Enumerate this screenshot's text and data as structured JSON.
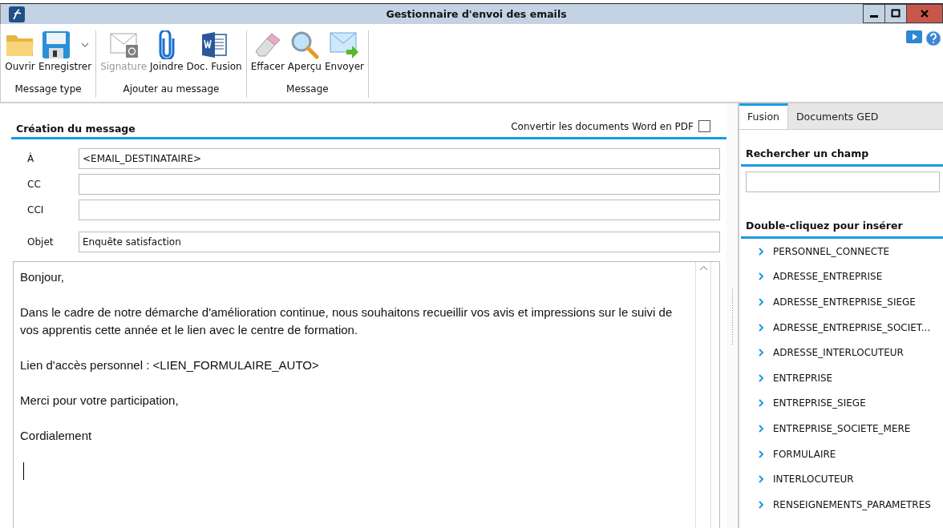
{
  "window": {
    "title": "Gestionnaire d'envoi des emails"
  },
  "toolbar": {
    "groups": [
      {
        "label": "Message type",
        "buttons": [
          {
            "label": "Ouvrir",
            "kind": "folder",
            "disabled": false,
            "dropdown": false
          },
          {
            "label": "Enregistrer",
            "kind": "save",
            "disabled": false,
            "dropdown": true
          }
        ]
      },
      {
        "label": "Ajouter au message",
        "buttons": [
          {
            "label": "Signature",
            "kind": "signature",
            "disabled": true,
            "dropdown": false
          },
          {
            "label": "Joindre",
            "kind": "clip",
            "disabled": false,
            "dropdown": false
          },
          {
            "label": "Doc. Fusion",
            "kind": "word",
            "disabled": false,
            "dropdown": false
          }
        ]
      },
      {
        "label": "Message",
        "buttons": [
          {
            "label": "Effacer",
            "kind": "eraser",
            "disabled": false,
            "dropdown": false
          },
          {
            "label": "Aperçu",
            "kind": "magnifier",
            "disabled": false,
            "dropdown": false
          },
          {
            "label": "Envoyer",
            "kind": "send",
            "disabled": false,
            "dropdown": false
          }
        ]
      }
    ]
  },
  "composer": {
    "title": "Création du message",
    "convert_pdf": {
      "label": "Convertir les documents Word en PDF",
      "checked": false
    },
    "fields": [
      {
        "label": "À",
        "value": "<EMAIL_DESTINATAIRE>"
      },
      {
        "label": "CC"
      },
      {
        "label": "CCI"
      },
      {
        "label": "Objet",
        "value": "Enquête satisfaction"
      }
    ],
    "body": [
      "Bonjour,",
      "Dans le cadre de notre démarche d'amélioration continue, nous souhaitons recueillir vos avis et impressions sur le suivi de vos apprentis cette année et le lien avec le centre de formation.",
      "Lien d'accès personnel : <LIEN_FORMULAIRE_AUTO>",
      "Merci pour votre participation,",
      "Cordialement"
    ]
  },
  "side_panel": {
    "tabs": [
      {
        "label": "Fusion",
        "selected": true
      },
      {
        "label": "Documents GED",
        "selected": false
      }
    ],
    "search_title": "Rechercher un champ",
    "list_title": "Double-cliquez pour insérer",
    "items": [
      "PERSONNEL_CONNECTE",
      "ADRESSE_ENTREPRISE",
      "ADRESSE_ENTREPRISE_SIEGE",
      "ADRESSE_ENTREPRISE_SOCIET...",
      "ADRESSE_INTERLOCUTEUR",
      "ENTREPRISE",
      "ENTREPRISE_SIEGE",
      "ENTREPRISE_SOCIETE_MERE",
      "FORMULAIRE",
      "INTERLOCUTEUR",
      "RENSEIGNEMENTS_PARAMETRES"
    ]
  }
}
